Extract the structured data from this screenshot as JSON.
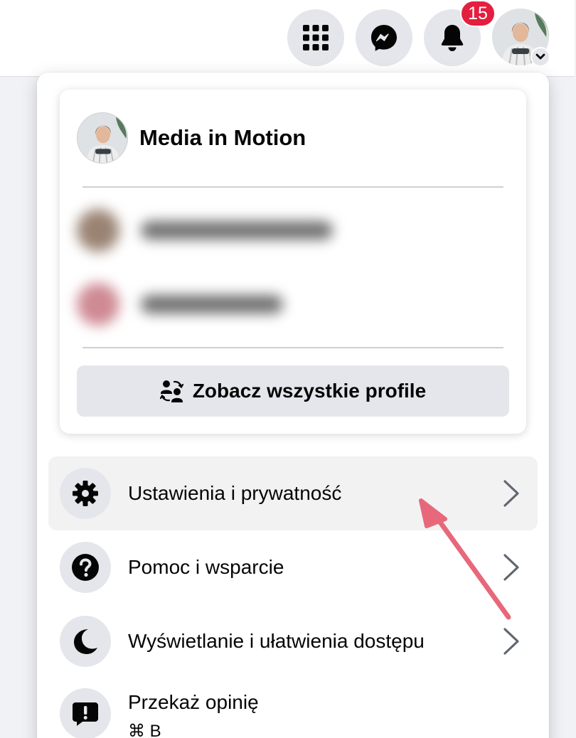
{
  "topbar": {
    "menu_icon": "grid-menu-icon",
    "messenger_icon": "messenger-icon",
    "notifications_icon": "bell-icon",
    "notifications_count": "15",
    "account_chevron_icon": "chevron-down-icon"
  },
  "profile_card": {
    "name": "Media in Motion",
    "see_all_label": "Zobacz wszystkie profile",
    "see_all_icon": "switch-profiles-icon"
  },
  "menu": {
    "items": [
      {
        "label": "Ustawienia i prywatność",
        "icon": "gear-icon"
      },
      {
        "label": "Pomoc i wsparcie",
        "icon": "question-icon"
      },
      {
        "label": "Wyświetlanie i ułatwienia dostępu",
        "icon": "moon-icon"
      },
      {
        "label": "Przekaż opinię",
        "icon": "feedback-icon",
        "shortcut": "⌘ B"
      }
    ]
  },
  "colors": {
    "notification_badge": "#e41e3f",
    "annotation_arrow": "#e8687b",
    "button_gray": "#e4e6eb"
  }
}
